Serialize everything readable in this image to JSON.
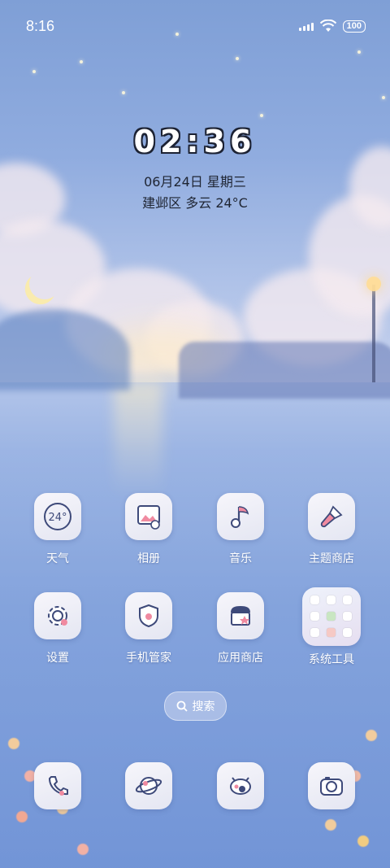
{
  "status_bar": {
    "time": "8:16",
    "battery": "100"
  },
  "widget": {
    "clock": "02:36",
    "date": "06月24日 星期三",
    "weather": "建邺区 多云 24°C"
  },
  "apps": [
    {
      "label": "天气",
      "icon": "weather-icon",
      "icon_text": "24°"
    },
    {
      "label": "相册",
      "icon": "gallery-icon"
    },
    {
      "label": "音乐",
      "icon": "music-icon"
    },
    {
      "label": "主题商店",
      "icon": "theme-store-icon"
    },
    {
      "label": "设置",
      "icon": "gear-icon"
    },
    {
      "label": "手机管家",
      "icon": "shield-icon"
    },
    {
      "label": "应用商店",
      "icon": "app-store-icon"
    },
    {
      "label": "系统工具",
      "icon": "folder-icon"
    }
  ],
  "search": {
    "label": "搜索",
    "icon": "search-icon"
  },
  "dock": [
    {
      "icon": "phone-icon"
    },
    {
      "icon": "browser-icon"
    },
    {
      "icon": "messages-icon"
    },
    {
      "icon": "camera-icon"
    }
  ],
  "colors": {
    "icon_stroke": "#3e4a7a",
    "accent_pink": "#f08aa0"
  }
}
